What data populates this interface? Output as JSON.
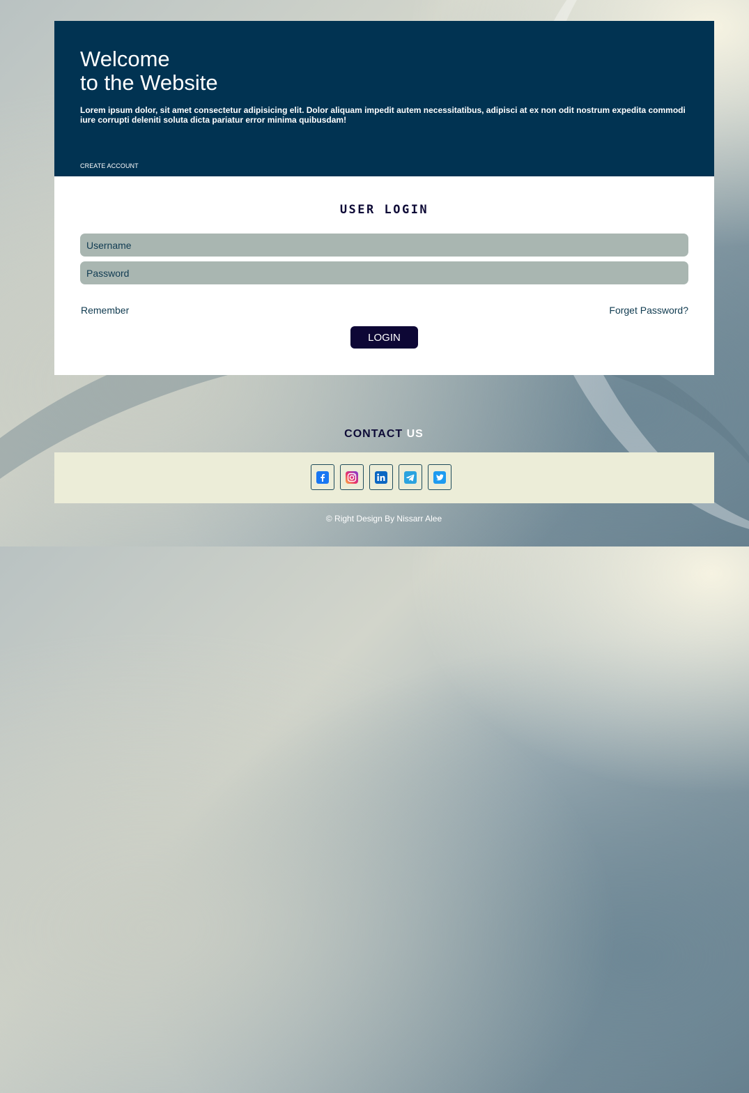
{
  "hero": {
    "title_line1": "Welcome",
    "title_line2": "to the Website",
    "text": "Lorem ipsum dolor, sit amet consectetur adipisicing elit. Dolor aliquam impedit autem necessitatibus, adipisci at ex non odit nostrum expedita commodi iure corrupti deleniti soluta dicta pariatur error minima quibusdam!",
    "create_account": "CREATE ACCOUNT"
  },
  "login": {
    "title": "USER LOGIN",
    "username_placeholder": "Username",
    "password_placeholder": "Password",
    "remember": "Remember",
    "forget": "Forget Password?",
    "button": "LOGIN"
  },
  "contact": {
    "title_word1": "CONTACT",
    "title_word2": "US",
    "socials": [
      "facebook-icon",
      "instagram-icon",
      "linkedin-icon",
      "telegram-icon",
      "twitter-icon"
    ]
  },
  "footer": {
    "copyright": "© Right Design By Nissarr Alee"
  },
  "colors": {
    "header_bg": "#013352",
    "button_bg": "#0d0735",
    "input_bg": "#a9b6b1",
    "social_bar_bg": "#ecedd8"
  }
}
